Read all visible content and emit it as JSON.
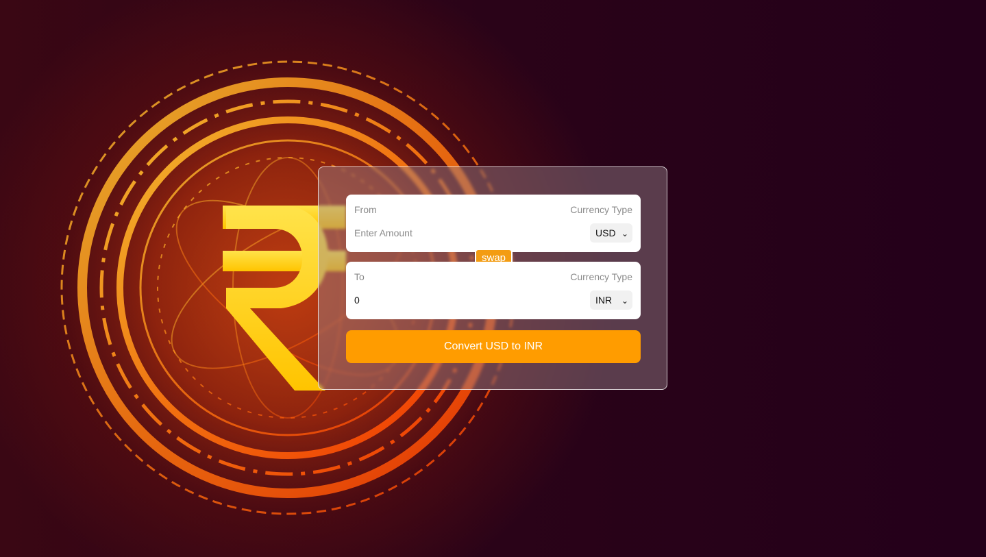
{
  "background": {
    "symbol": "₹",
    "accent_color": "#ff8c1a",
    "symbol_color": "#ffd400"
  },
  "converter": {
    "from": {
      "label": "From",
      "currency_type_label": "Currency Type",
      "amount_placeholder": "Enter Amount",
      "amount_value": "",
      "currency": "USD"
    },
    "swap_label": "swap",
    "to": {
      "label": "To",
      "currency_type_label": "Currency Type",
      "amount_value": "0",
      "currency": "INR"
    },
    "convert_label": "Convert USD to INR",
    "button_color": "#ff9c00",
    "swap_color": "#f39c12"
  }
}
